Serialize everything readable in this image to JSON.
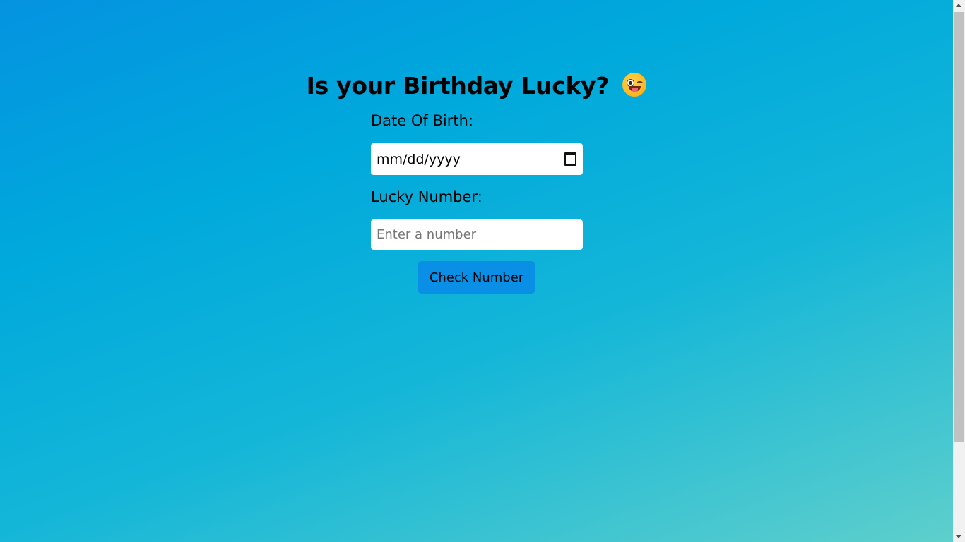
{
  "title": "Is your Birthday Lucky?",
  "title_emoji": "winking-face-with-tongue",
  "form": {
    "dob_label": "Date Of Birth:",
    "dob_value": "mm/dd/yyyy",
    "dob_icon": "calendar-icon",
    "lucky_label": "Lucky Number:",
    "lucky_placeholder": "Enter a number",
    "lucky_value": "",
    "check_button": "Check Number"
  },
  "colors": {
    "gradient_start": "#0493e0",
    "gradient_end": "#5ecfcc",
    "button": "#0a8fe6"
  }
}
